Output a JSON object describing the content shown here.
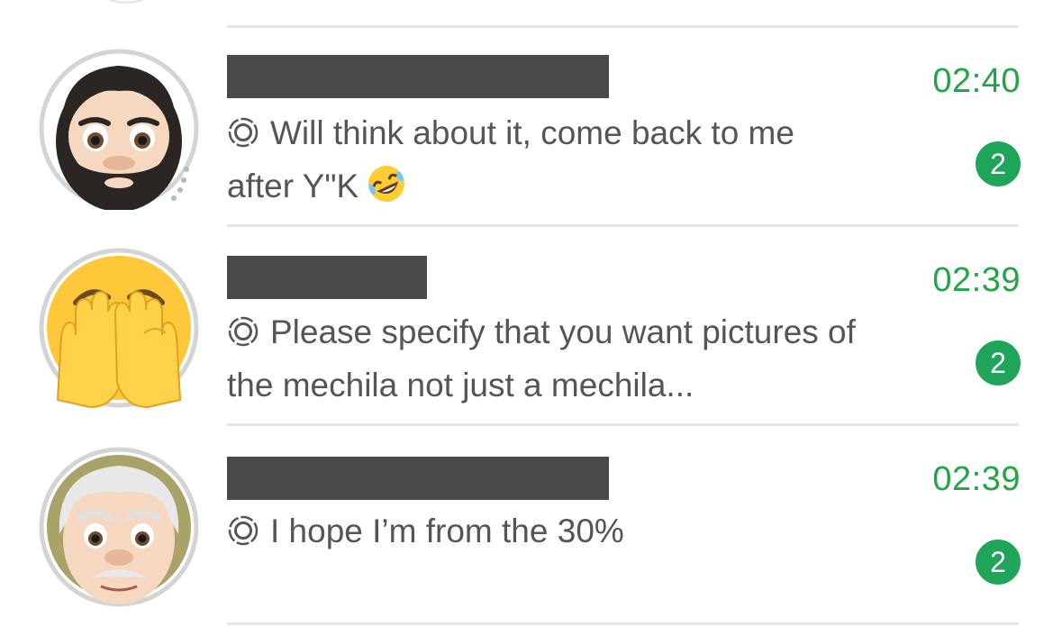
{
  "chats": [
    {
      "time": "02:40",
      "unread": "2",
      "preview_line1": "Will think about it, come back to me",
      "preview_line2": "after Y\"K",
      "preview_emoji": "rolling-on-floor-laughing-emoji",
      "avatar": "bearded-man-emoji"
    },
    {
      "time": "02:39",
      "unread": "2",
      "preview_line1": "Please specify that you want pictures of",
      "preview_line2": "the mechila not just a mechila...",
      "avatar": "face-with-peeking-eye-emoji"
    },
    {
      "time": "02:39",
      "unread": "2",
      "preview_line1": "I hope I’m from the 30%",
      "avatar": "older-man-emoji"
    }
  ],
  "colors": {
    "accent_green": "#22a447",
    "badge_green": "#1fa55a",
    "redaction": "#4a4a4a",
    "preview_text": "#555555",
    "divider": "#e5e5e5"
  },
  "icons": {
    "status": "status-ring-icon"
  }
}
